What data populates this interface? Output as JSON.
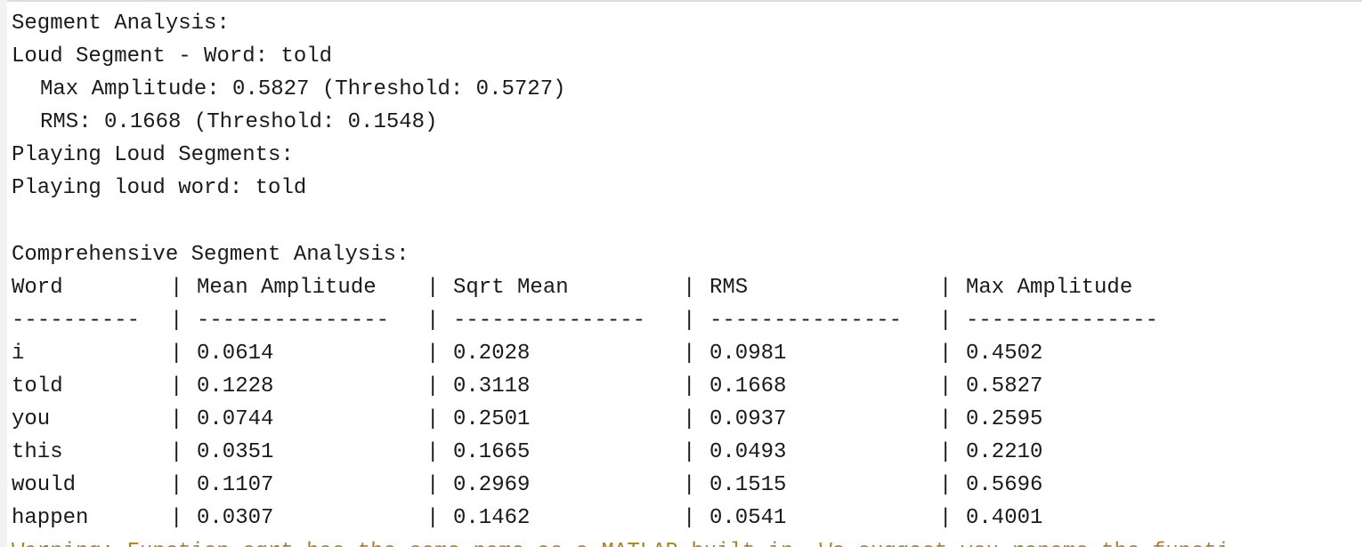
{
  "console": {
    "segment_analysis_header": "Segment Analysis:",
    "loud_segment_line": "Loud Segment - Word: told",
    "max_amplitude_line": "Max Amplitude: 0.5827 (Threshold: 0.5727)",
    "rms_line": "RMS: 0.1668 (Threshold: 0.1548)",
    "playing_loud_segments": "Playing Loud Segments:",
    "playing_loud_word": "Playing loud word: told",
    "comprehensive_header": "Comprehensive Segment Analysis:",
    "table": {
      "separator": "|",
      "headers": [
        "Word",
        "Mean Amplitude",
        "Sqrt Mean",
        "RMS",
        "Max Amplitude"
      ],
      "dashes": [
        "----------",
        "---------------",
        "---------------",
        "---------------",
        "---------------"
      ],
      "rows": [
        [
          "i",
          "0.0614",
          "0.2028",
          "0.0981",
          "0.4502"
        ],
        [
          "told",
          "0.1228",
          "0.3118",
          "0.1668",
          "0.5827"
        ],
        [
          "you",
          "0.0744",
          "0.2501",
          "0.0937",
          "0.2595"
        ],
        [
          "this",
          "0.0351",
          "0.1665",
          "0.0493",
          "0.2210"
        ],
        [
          "would",
          "0.1107",
          "0.2969",
          "0.1515",
          "0.5696"
        ],
        [
          "happen",
          "0.0307",
          "0.1462",
          "0.0541",
          "0.4001"
        ]
      ]
    },
    "warning": "Warning: Function sqrt has the same name as a MATLAB built-in. We suggest you rename the functi",
    "warning_color": "#b3801e"
  }
}
